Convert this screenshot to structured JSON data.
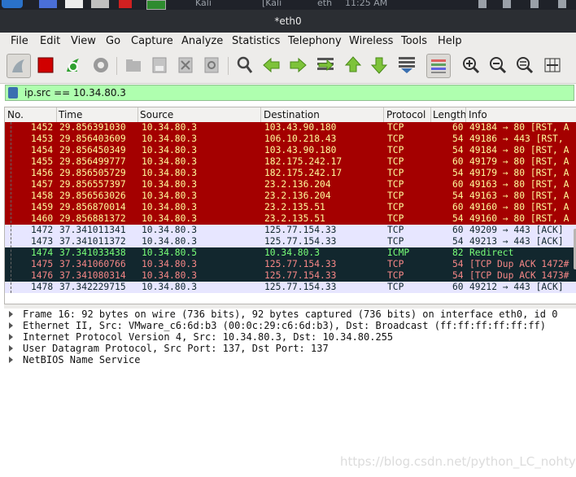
{
  "taskbar": {
    "items": [
      "Kali",
      "[Kali",
      "eth",
      "11:25 AM"
    ]
  },
  "window": {
    "title": "*eth0"
  },
  "menu": [
    "File",
    "Edit",
    "View",
    "Go",
    "Capture",
    "Analyze",
    "Statistics",
    "Telephony",
    "Wireless",
    "Tools",
    "Help"
  ],
  "toolbar_icons": [
    "shark-fin-start-icon",
    "stop-capture-icon",
    "restart-capture-icon",
    "capture-options-icon",
    "open-file-icon",
    "save-file-icon",
    "close-file-icon",
    "reload-file-icon",
    "find-packet-icon",
    "go-back-icon",
    "go-forward-icon",
    "go-to-packet-icon",
    "go-first-icon",
    "go-last-icon",
    "autoscroll-icon",
    "colorize-icon",
    "zoom-in-icon",
    "zoom-out-icon",
    "zoom-reset-icon",
    "resize-columns-icon"
  ],
  "filter": {
    "text": "ip.src == 10.34.80.3"
  },
  "columns": [
    "No.",
    "Time",
    "Source",
    "Destination",
    "Protocol",
    "Length",
    "Info"
  ],
  "packets": [
    {
      "no": "1452",
      "time": "29.856391030",
      "src": "10.34.80.3",
      "dst": "103.43.90.180",
      "proto": "TCP",
      "len": "60",
      "info": "49184 → 80 [RST, A",
      "style": "red"
    },
    {
      "no": "1453",
      "time": "29.856403609",
      "src": "10.34.80.3",
      "dst": "106.10.218.43",
      "proto": "TCP",
      "len": "54",
      "info": "49186 → 443 [RST,",
      "style": "red"
    },
    {
      "no": "1454",
      "time": "29.856450349",
      "src": "10.34.80.3",
      "dst": "103.43.90.180",
      "proto": "TCP",
      "len": "54",
      "info": "49184 → 80 [RST, A",
      "style": "red"
    },
    {
      "no": "1455",
      "time": "29.856499777",
      "src": "10.34.80.3",
      "dst": "182.175.242.17",
      "proto": "TCP",
      "len": "60",
      "info": "49179 → 80 [RST, A",
      "style": "red"
    },
    {
      "no": "1456",
      "time": "29.856505729",
      "src": "10.34.80.3",
      "dst": "182.175.242.17",
      "proto": "TCP",
      "len": "54",
      "info": "49179 → 80 [RST, A",
      "style": "red"
    },
    {
      "no": "1457",
      "time": "29.856557397",
      "src": "10.34.80.3",
      "dst": "23.2.136.204",
      "proto": "TCP",
      "len": "60",
      "info": "49163 → 80 [RST, A",
      "style": "red"
    },
    {
      "no": "1458",
      "time": "29.856563026",
      "src": "10.34.80.3",
      "dst": "23.2.136.204",
      "proto": "TCP",
      "len": "54",
      "info": "49163 → 80 [RST, A",
      "style": "red"
    },
    {
      "no": "1459",
      "time": "29.856870014",
      "src": "10.34.80.3",
      "dst": "23.2.135.51",
      "proto": "TCP",
      "len": "60",
      "info": "49160 → 80 [RST, A",
      "style": "red"
    },
    {
      "no": "1460",
      "time": "29.856881372",
      "src": "10.34.80.3",
      "dst": "23.2.135.51",
      "proto": "TCP",
      "len": "54",
      "info": "49160 → 80 [RST, A",
      "style": "red"
    },
    {
      "no": "1472",
      "time": "37.341011341",
      "src": "10.34.80.3",
      "dst": "125.77.154.33",
      "proto": "TCP",
      "len": "60",
      "info": "49209 → 443 [ACK]",
      "style": "lav"
    },
    {
      "no": "1473",
      "time": "37.341011372",
      "src": "10.34.80.3",
      "dst": "125.77.154.33",
      "proto": "TCP",
      "len": "54",
      "info": "49213 → 443 [ACK]",
      "style": "lav"
    },
    {
      "no": "1474",
      "time": "37.341033438",
      "src": "10.34.80.5",
      "dst": "10.34.80.3",
      "proto": "ICMP",
      "len": "82",
      "info": "Redirect",
      "style": "dark"
    },
    {
      "no": "1475",
      "time": "37.341060766",
      "src": "10.34.80.3",
      "dst": "125.77.154.33",
      "proto": "TCP",
      "len": "54",
      "info": "[TCP Dup ACK 1472#",
      "style": "darkr"
    },
    {
      "no": "1476",
      "time": "37.341080314",
      "src": "10.34.80.3",
      "dst": "125.77.154.33",
      "proto": "TCP",
      "len": "54",
      "info": "[TCP Dup ACK 1473#",
      "style": "darkr"
    },
    {
      "no": "1478",
      "time": "37.342229715",
      "src": "10.34.80.3",
      "dst": "125.77.154.33",
      "proto": "TCP",
      "len": "60",
      "info": "49212 → 443 [ACK]",
      "style": "lav"
    }
  ],
  "details": [
    "Frame 16: 92 bytes on wire (736 bits), 92 bytes captured (736 bits) on interface eth0, id 0",
    "Ethernet II, Src: VMware_c6:6d:b3 (00:0c:29:c6:6d:b3), Dst: Broadcast (ff:ff:ff:ff:ff:ff)",
    "Internet Protocol Version 4, Src: 10.34.80.3, Dst: 10.34.80.255",
    "User Datagram Protocol, Src Port: 137, Dst Port: 137",
    "NetBIOS Name Service"
  ],
  "watermark": "https://blog.csdn.net/python_LC_nohtyp"
}
